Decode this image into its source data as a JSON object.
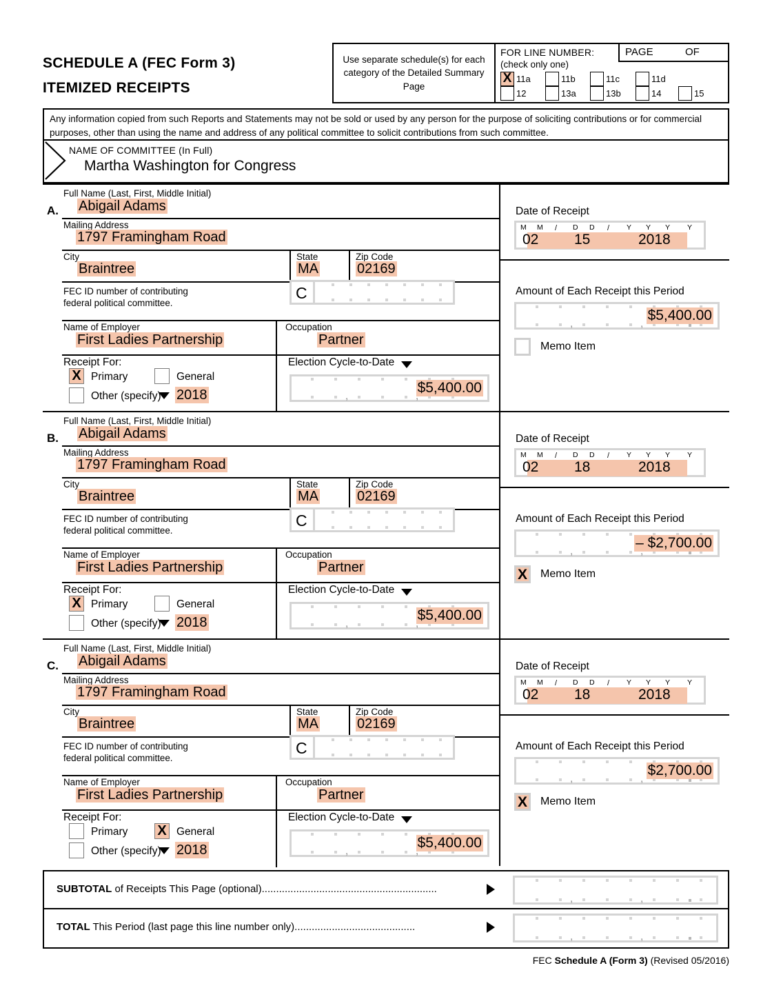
{
  "header": {
    "title_line1": "SCHEDULE A  (FEC Form 3)",
    "title_line2": "ITEMIZED RECEIPTS",
    "use_separate": "Use separate schedule(s) for each category of the Detailed Summary Page",
    "for_line_number": "FOR LINE NUMBER:",
    "check_only_one": "(check only one)",
    "page_label": "PAGE",
    "of_label": "OF",
    "page_value": "",
    "of_value": "",
    "line_options": [
      {
        "label": "11a",
        "checked": true
      },
      {
        "label": "11b",
        "checked": false
      },
      {
        "label": "11c",
        "checked": false
      },
      {
        "label": "11d",
        "checked": false
      },
      {
        "label": "12",
        "checked": false
      },
      {
        "label": "13a",
        "checked": false
      },
      {
        "label": "13b",
        "checked": false
      },
      {
        "label": "14",
        "checked": false
      },
      {
        "label": "15",
        "checked": false
      }
    ]
  },
  "disclaimer": "Any information copied from such Reports and Statements may not be sold or used by any person for the purpose of soliciting contributions or for commercial purposes, other than using the name and address of any political committee to solicit contributions from such committee.",
  "committee": {
    "label": "NAME OF COMMITTEE (In Full)",
    "value": "Martha Washington for Congress"
  },
  "labels": {
    "full_name": "Full Name (Last, First, Middle Initial)",
    "mailing_address": "Mailing Address",
    "city": "City",
    "state": "State",
    "zip": "Zip Code",
    "fec_id_line1": "FEC ID number of contributing",
    "fec_id_line2": "federal political committee.",
    "fec_id_prefix": "C",
    "employer": "Name of Employer",
    "occupation": "Occupation",
    "receipt_for": "Receipt For:",
    "primary": "Primary",
    "general": "General",
    "other": "Other (specify)",
    "election_cycle": "Election Cycle-to-Date",
    "date_of_receipt": "Date of Receipt",
    "amount_each": "Amount of Each Receipt this Period",
    "memo_item": "Memo Item",
    "date_m": "M",
    "date_d": "D",
    "date_y": "Y",
    "date_slash": "/"
  },
  "records": [
    {
      "letter": "A.",
      "full_name": "Abigail Adams",
      "mailing_address": "1797 Framingham Road",
      "city": "Braintree",
      "state": "MA",
      "zip": "02169",
      "fec_id": "",
      "employer": "First Ladies Partnership",
      "occupation": "Partner",
      "receipt_primary": true,
      "receipt_general": false,
      "receipt_other": false,
      "other_value": "2018",
      "election_cycle_to_date": "$5,400.00",
      "date_mm": "02",
      "date_dd": "15",
      "date_yyyy": "2018",
      "amount": "$5,400.00",
      "memo_item": false
    },
    {
      "letter": "B.",
      "full_name": "Abigail Adams",
      "mailing_address": "1797 Framingham Road",
      "city": "Braintree",
      "state": "MA",
      "zip": "02169",
      "fec_id": "",
      "employer": "First Ladies Partnership",
      "occupation": "Partner",
      "receipt_primary": true,
      "receipt_general": false,
      "receipt_other": false,
      "other_value": "2018",
      "election_cycle_to_date": "$5,400.00",
      "date_mm": "02",
      "date_dd": "18",
      "date_yyyy": "2018",
      "amount": "– $2,700.00",
      "memo_item": true
    },
    {
      "letter": "C.",
      "full_name": "Abigail Adams",
      "mailing_address": "1797 Framingham Road",
      "city": "Braintree",
      "state": "MA",
      "zip": "02169",
      "fec_id": "",
      "employer": "First Ladies Partnership",
      "occupation": "Partner",
      "receipt_primary": false,
      "receipt_general": true,
      "receipt_other": false,
      "other_value": "2018",
      "election_cycle_to_date": "$5,400.00",
      "date_mm": "02",
      "date_dd": "18",
      "date_yyyy": "2018",
      "amount": "$2,700.00",
      "memo_item": true
    }
  ],
  "totals": {
    "subtotal_bold": "SUBTOTAL",
    "subtotal_rest": " of Receipts This Page (optional)",
    "subtotal_dots": ".............................................................",
    "subtotal_value": "",
    "total_bold": "TOTAL",
    "total_rest": " This Period (last page this line number only)",
    "total_dots": "..........................................",
    "total_value": ""
  },
  "footer": {
    "prefix": "FEC ",
    "bold": "Schedule A (Form 3)",
    "suffix": " (Revised 05/2016)"
  },
  "colors": {
    "highlight": "#f5c5ac",
    "border": "#000000",
    "box_gray": "#d4d4d4"
  }
}
